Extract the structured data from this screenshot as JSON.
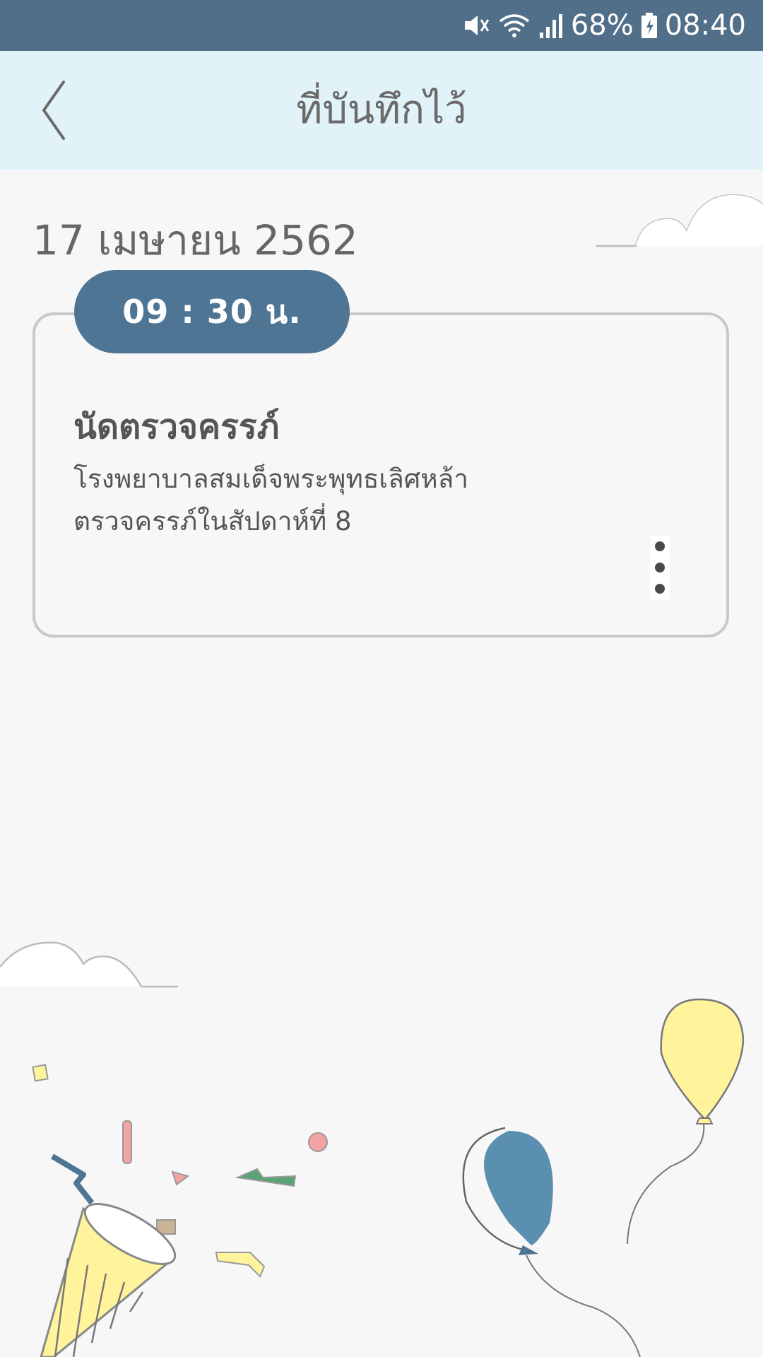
{
  "status_bar": {
    "battery_text": "68%",
    "time": "08:40",
    "icons": [
      "mute-icon",
      "wifi-icon",
      "signal-icon",
      "battery-charging-icon"
    ],
    "background_color": "#516f89"
  },
  "header": {
    "title": "ที่บันทึกไว้",
    "back_icon": "chevron-left-icon",
    "background_color": "#e1f2f8"
  },
  "date_heading": "17 เมษายน 2562",
  "appointment": {
    "time": "09 : 30 น.",
    "title": "นัดตรวจครรภ์",
    "location": "โรงพยาบาลสมเด็จพระพุทธเลิศหล้า",
    "note": "ตรวจครรภ์ในสัปดาห์ที่ 8",
    "menu_icon": "more-vertical-icon",
    "accent_color": "#4f7594"
  },
  "decorations": {
    "icons": [
      "cloud-icon",
      "party-popper-icon",
      "confetti-icon",
      "balloon-icon"
    ],
    "balloon_colors": [
      "#5a8fb0",
      "#fff49c"
    ]
  }
}
